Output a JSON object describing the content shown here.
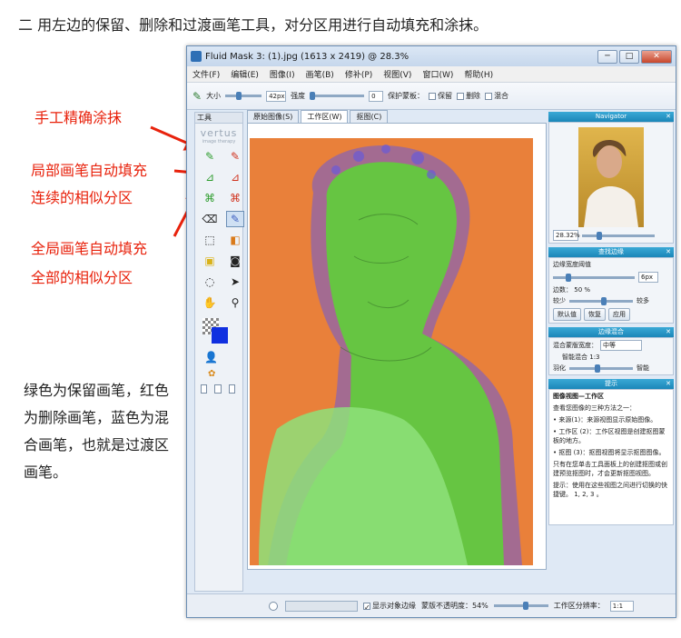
{
  "heading": "二 用左边的保留、删除和过渡画笔工具，对分区用进行自动填充和涂抹。",
  "annotations": {
    "manual": "手工精确涂抹",
    "local_line1": "局部画笔自动填充",
    "local_line2": "连续的相似分区",
    "global_line1": "全局画笔自动填充",
    "global_line2": "全部的相似分区"
  },
  "description": "绿色为保留画笔，红色为删除画笔，蓝色为混合画笔，也就是过渡区画笔。",
  "colors": {
    "annotation": "#e8220c",
    "keep": "#5fcf3a",
    "blend": "#6a5ad8",
    "background_photo": "#e9803a",
    "panel_header": "#1b86b8"
  },
  "window": {
    "title": "Fluid Mask 3: (1).jpg (1613 x 2419) @ 28.3%",
    "buttons": [
      "─",
      "□",
      "✕"
    ]
  },
  "menu": [
    "文件(F)",
    "编辑(E)",
    "图像(I)",
    "画笔(B)",
    "修补(P)",
    "视图(V)",
    "窗口(W)",
    "帮助(H)"
  ],
  "toolbar": {
    "size_label": "大小",
    "size_value": "42px",
    "strength_label": "强度",
    "strength_value": "0",
    "protect_label": "保护蒙板：",
    "keep": "保留",
    "delete": "删除",
    "blend": "混合"
  },
  "tool_panel": {
    "title": "工具",
    "logo": "vertus",
    "logo_sub": "image therapy"
  },
  "tabs": [
    "原始图像(S)",
    "工作区(W)",
    "抠图(C)"
  ],
  "navigator": {
    "title": "Navigator",
    "zoom": "28.32%"
  },
  "edge": {
    "title": "查找边缘",
    "label": "边缘宽度阈值",
    "value": "6px",
    "count_label": "边数：",
    "count": "50 %",
    "less": "较少",
    "more": "较多",
    "btn_default": "默认值",
    "btn_restore": "恢复",
    "btn_apply": "应用"
  },
  "blend": {
    "title": "边缘混合",
    "mode_label": "混合蒙版宽度：",
    "mode": "中等",
    "ratio_label": "智能混合",
    "ratio": "1:3",
    "feather": "羽化",
    "smart": "智能"
  },
  "hint": {
    "title": "提示",
    "heading": "图像视图—工作区",
    "lines": [
      "查看您图像的三种方法之一：",
      "• 来源(1)：来源视图显示原始图像。",
      "• 工作区 (2)：工作区视图是创建抠图蒙板的地方。",
      "• 抠图 (3)：抠图视图将显示抠图图像。",
      "只有在您单击工具面板上的创建抠图或创建预览抠图时，才会更新抠图视图。",
      "提示：使用在这些视图之间进行切换的快捷键。 1, 2, 3 。"
    ]
  },
  "status": {
    "show_edges": "显示对象边缘",
    "opacity_label": "蒙版不透明度：54%",
    "resolution_label": "工作区分辨率：",
    "resolution": "1:1"
  }
}
